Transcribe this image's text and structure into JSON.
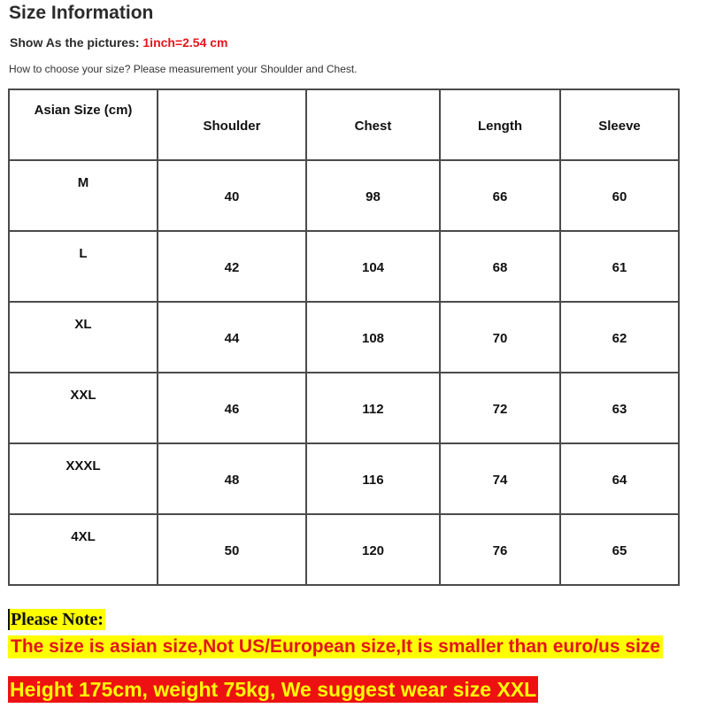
{
  "header": {
    "title": "Size Information",
    "subtitle_label": "Show As the pictures: ",
    "subtitle_conversion": "1inch=2.54 cm",
    "howto": "How to choose your size? Please measurement your Shoulder and Chest."
  },
  "table": {
    "columns": [
      "Asian Size  (cm)",
      "Shoulder",
      "Chest",
      "Length",
      "Sleeve"
    ],
    "rows": [
      {
        "size": "M",
        "shoulder": "40",
        "chest": "98",
        "length": "66",
        "sleeve": "60"
      },
      {
        "size": "L",
        "shoulder": "42",
        "chest": "104",
        "length": "68",
        "sleeve": "61"
      },
      {
        "size": "XL",
        "shoulder": "44",
        "chest": "108",
        "length": "70",
        "sleeve": "62"
      },
      {
        "size": "XXL",
        "shoulder": "46",
        "chest": "112",
        "length": "72",
        "sleeve": "63"
      },
      {
        "size": "XXXL",
        "shoulder": "48",
        "chest": "116",
        "length": "74",
        "sleeve": "64"
      },
      {
        "size": "4XL",
        "shoulder": "50",
        "chest": "120",
        "length": "76",
        "sleeve": "65"
      }
    ]
  },
  "notes": {
    "label": "Please Note:",
    "line1": "The size is asian size,Not US/European size,It is smaller than euro/us size",
    "line2": "Height 175cm, weight 75kg, We suggest wear size XXL"
  },
  "colors": {
    "accent_red": "#e3161c",
    "highlight_yellow": "#ffff00",
    "banner_red": "#ee1111",
    "border": "#4a4a4a"
  }
}
